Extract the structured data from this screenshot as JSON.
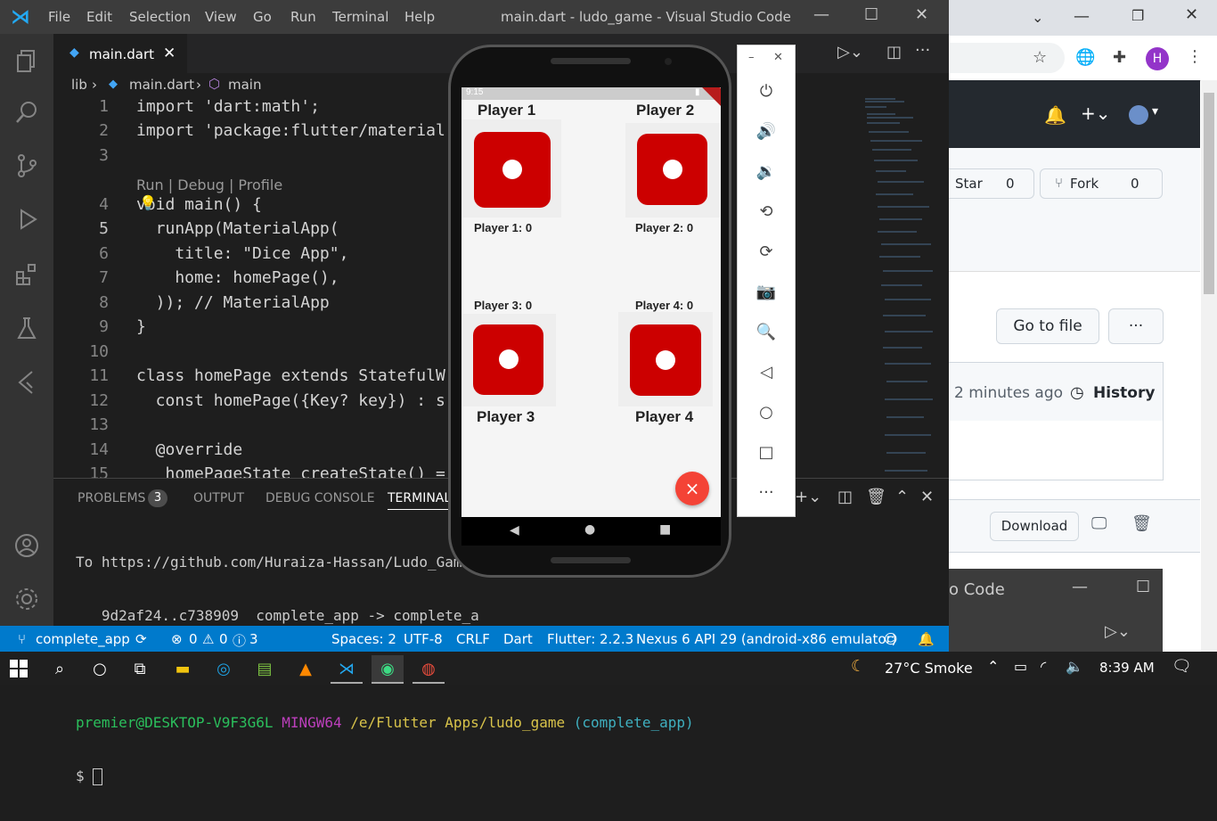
{
  "vscode": {
    "menu": [
      "File",
      "Edit",
      "Selection",
      "View",
      "Go",
      "Run",
      "Terminal",
      "Help"
    ],
    "window_title": "main.dart - ludo_game - Visual Studio Code",
    "tab_label": "main.dart",
    "breadcrumb": {
      "folder": "lib",
      "file": "main.dart",
      "symbol": "main"
    },
    "codelens": "Run | Debug | Profile",
    "lines": [
      {
        "n": "1",
        "t": "import 'dart:math';"
      },
      {
        "n": "2",
        "t": "import 'package:flutter/material"
      },
      {
        "n": "3",
        "t": ""
      },
      {
        "n": "4",
        "t": "void main() {"
      },
      {
        "n": "5",
        "t": "  runApp(MaterialApp("
      },
      {
        "n": "6",
        "t": "    title: \"Dice App\","
      },
      {
        "n": "7",
        "t": "    home: homePage(),"
      },
      {
        "n": "8",
        "t": "  )); // MaterialApp"
      },
      {
        "n": "9",
        "t": "}"
      },
      {
        "n": "10",
        "t": ""
      },
      {
        "n": "11",
        "t": "class homePage extends StatefulW"
      },
      {
        "n": "12",
        "t": "  const homePage({Key? key}) : s"
      },
      {
        "n": "13",
        "t": ""
      },
      {
        "n": "14",
        "t": "  @override"
      },
      {
        "n": "15",
        "t": "  _homePageState createState() ="
      }
    ],
    "panel_tabs": [
      "PROBLEMS",
      "OUTPUT",
      "DEBUG CONSOLE",
      "TERMINAL"
    ],
    "problems_count": "3",
    "terminal_lines": [
      "To https://github.com/Huraiza-Hassan/Ludo_Game.",
      "   9d2af24..c738909  complete_app -> complete_a",
      "",
      "premier@DESKTOP-V9F3G6L MINGW64 /e/Flutter Apps/ludo_game (complete_app)",
      "$ "
    ],
    "terminal_prompt": {
      "user": "premier@DESKTOP-V9F3G6L",
      "env": "MINGW64",
      "path": "/e/Flutter Apps/ludo_game",
      "branch": "(complete_app)",
      "dollar": "$"
    },
    "status": {
      "branch": "complete_app",
      "errors": "0",
      "warnings": "0",
      "infos": "3",
      "spaces": "Spaces: 2",
      "encoding": "UTF-8",
      "eol": "CRLF",
      "language": "Dart",
      "flutter": "Flutter: 2.2.3",
      "device": "Nexus 6 API 29 (android-x86 emulator)"
    }
  },
  "emulator": {
    "clock": "9:15",
    "players": [
      {
        "name": "Player 1",
        "score": "Player 1: 0"
      },
      {
        "name": "Player 2",
        "score": "Player 2: 0"
      },
      {
        "name": "Player 3",
        "score": "Player 3: 0"
      },
      {
        "name": "Player 4",
        "score": "Player 4: 0"
      }
    ],
    "fab_icon": "×"
  },
  "browser": {
    "star_label": "Star",
    "star_count": "0",
    "fork_label": "Fork",
    "fork_count": "0",
    "go_to_file": "Go to file",
    "more_label": "···",
    "commit_time": "2 minutes ago",
    "history_label": "History",
    "download_label": "Download",
    "avatar_letter": "H",
    "underlying_window_title": "o Code"
  },
  "taskbar": {
    "weather": "27°C  Smoke",
    "time": "8:39 AM"
  }
}
